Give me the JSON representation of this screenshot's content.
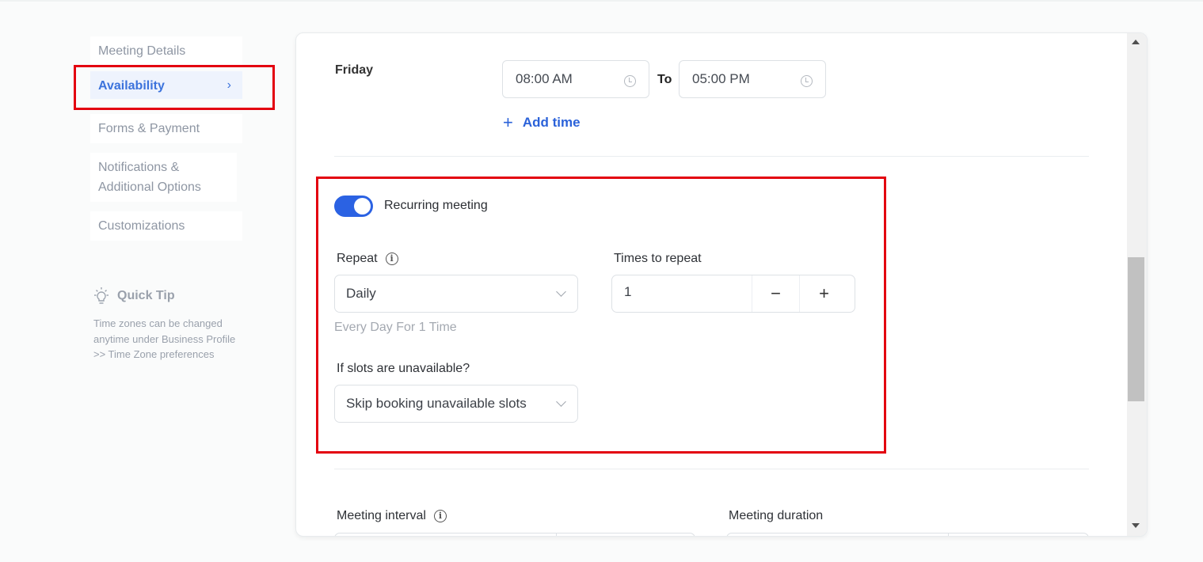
{
  "sidebar": {
    "items": [
      {
        "label": "Meeting Details"
      },
      {
        "label": "Availability",
        "chevron": "›"
      },
      {
        "label": "Forms & Payment"
      },
      {
        "label": "Notifications & Additional Options"
      },
      {
        "label": "Customizations"
      }
    ],
    "active_index": 1
  },
  "quick_tip": {
    "icon": "lightbulb-icon",
    "title": "Quick Tip",
    "text": "Time zones can be changed anytime under Business Profile >> Time Zone preferences"
  },
  "availability": {
    "day": "Friday",
    "start_time": "08:00 AM",
    "to_label": "To",
    "end_time": "05:00 PM",
    "add_time_label": "Add time",
    "add_time_icon": "+"
  },
  "recurring": {
    "toggle_on": true,
    "toggle_label": "Recurring meeting",
    "repeat_label": "Repeat",
    "repeat_value": "Daily",
    "repeat_hint": "Every Day For 1 Time",
    "times_label": "Times to repeat",
    "times_value": "1",
    "minus": "−",
    "plus": "+",
    "unavailable_label": "If slots are unavailable?",
    "unavailable_value": "Skip booking unavailable slots"
  },
  "interval": {
    "interval_label": "Meeting interval",
    "duration_label": "Meeting duration"
  },
  "colors": {
    "accent": "#2b62e3",
    "highlight": "#e3000f",
    "active_bg": "#eef3fd"
  }
}
